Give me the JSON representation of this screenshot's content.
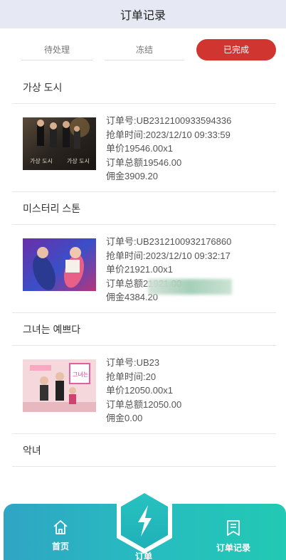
{
  "header": {
    "title": "订单记录"
  },
  "tabs": [
    {
      "label": "待处理"
    },
    {
      "label": "冻结"
    },
    {
      "label": "已完成"
    }
  ],
  "orders": [
    {
      "title": "가상 도시",
      "order_no": "订单号:UB2312100933594336",
      "grab_time": "抢单时间:2023/12/10 09:33:59",
      "unit_price": "单价19546.00x1",
      "total": "订单总额19546.00",
      "commission": "佣金3909.20",
      "poster_text": "가상 도시"
    },
    {
      "title": "미스터리 스톤",
      "order_no": "订单号:UB2312100932176860",
      "grab_time": "抢单时间:2023/12/10 09:32:17",
      "unit_price": "单价21921.00x1",
      "total": "订单总额21921.00",
      "commission": "佣金4384.20"
    },
    {
      "title": "그녀는 예쁘다",
      "order_no": "订单号:UB23",
      "grab_time": "抢单时间:20",
      "unit_price": "单价12050.00x1",
      "total": "订单总额12050.00",
      "commission": "佣金0.00",
      "poster_text": "그녀는"
    },
    {
      "title": "악녀"
    }
  ],
  "bottom_nav": {
    "home_label": "首页",
    "center_label": "订单",
    "orders_label": "订单记录"
  },
  "colors": {
    "header_bg": "#e6e9f4",
    "active_tab": "#d0352f",
    "nav_gradient_start": "#2fa5c4",
    "nav_gradient_end": "#22c9b3"
  }
}
